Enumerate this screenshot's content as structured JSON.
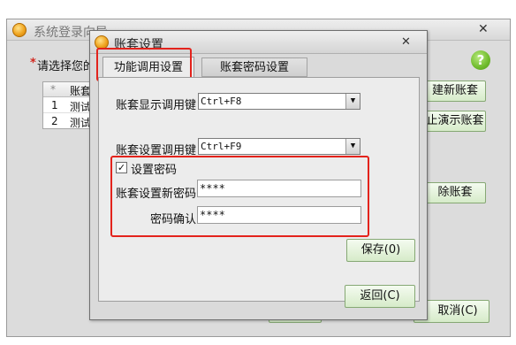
{
  "background_window": {
    "title": "系统登录向导",
    "prompt": "请选择您的",
    "asterisk": "*",
    "table": {
      "header": [
        "*",
        "账套"
      ],
      "rows": [
        [
          "1",
          "测试"
        ],
        [
          "2",
          "测试"
        ]
      ]
    },
    "buttons": {
      "new_account": "建新账套",
      "demo": "止演示账套",
      "delete": "除账套",
      "cancel": "取消(C)"
    },
    "help_glyph": "?"
  },
  "dialog": {
    "title": "账套设置",
    "close_glyph": "✕",
    "tabs": [
      {
        "label": "功能调用设置",
        "active": true
      },
      {
        "label": "账套密码设置",
        "active": false
      }
    ],
    "fields": {
      "display_key_label": "账套显示调用键",
      "display_key_value": "Ctrl+F8",
      "settings_key_label": "账套设置调用键",
      "settings_key_value": "Ctrl+F9",
      "set_password_label": "设置密码",
      "set_password_checked": true,
      "new_password_label": "账套设置新密码",
      "new_password_value": "****",
      "confirm_label": "密码确认",
      "confirm_value": "****"
    },
    "buttons": {
      "save": "保存(0)",
      "back": "返回(C)"
    },
    "dropdown_glyph": "▼",
    "check_glyph": "✓"
  },
  "colors": {
    "highlight_red": "#e3231c",
    "button_green": "#d6ebc9",
    "help_green": "#6fbb2c"
  }
}
